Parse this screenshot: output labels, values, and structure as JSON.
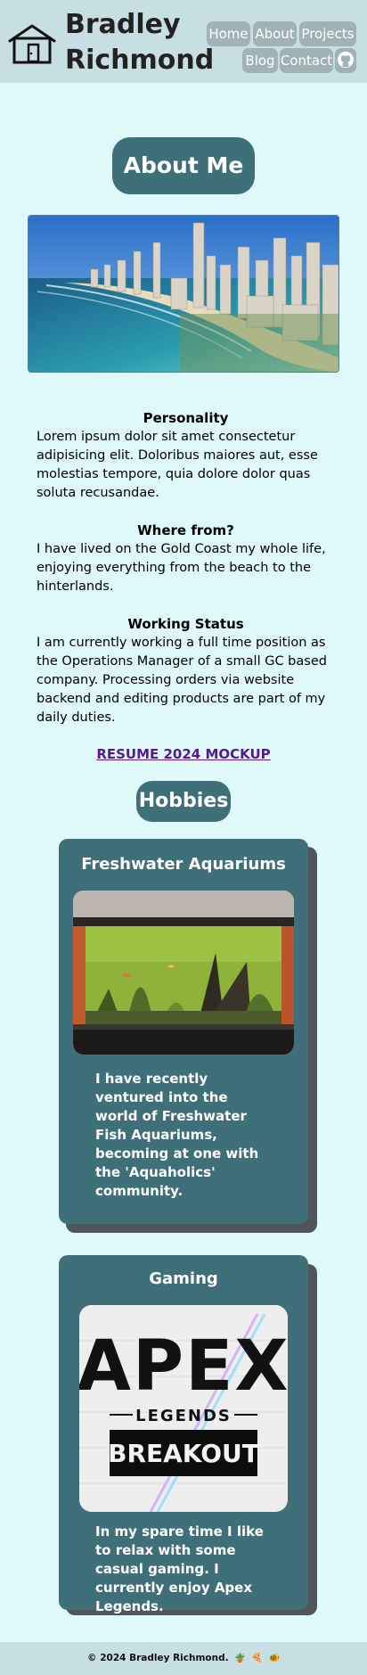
{
  "header": {
    "title_line1": "Bradley",
    "title_line2": "Richmond",
    "nav": {
      "home": "Home",
      "about": "About",
      "projects": "Projects",
      "blog": "Blog",
      "contact": "Contact"
    }
  },
  "about": {
    "heading": "About Me",
    "blocks": [
      {
        "title": "Personality",
        "text": "Lorem ipsum dolor sit amet consectetur adipisicing elit. Doloribus maiores aut, esse molestias tempore, quia dolore dolor quas soluta recusandae."
      },
      {
        "title": "Where from?",
        "text": "I have lived on the Gold Coast my whole life, enjoying everything from the beach to the hinterlands."
      },
      {
        "title": "Working Status",
        "text": "I am currently working a full time position as the Operations Manager of a small GC based company. Processing orders via website backend and editing products are part of my daily duties."
      }
    ],
    "resume_link": "RESUME 2024 MOCKUP"
  },
  "hobbies": {
    "heading": "Hobbies",
    "cards": [
      {
        "title": "Freshwater Aquariums",
        "text": "I have recently ventured into the world of Freshwater Fish Aquariums, becoming at one with the 'Aquaholics' community."
      },
      {
        "title": "Gaming",
        "text": "In my spare time I like to relax with some casual gaming. I currently enjoy Apex Legends.",
        "image_text": {
          "line1": "APEX",
          "line2": "LEGENDS",
          "line3": "BREAKOUT"
        }
      }
    ]
  },
  "footer": {
    "text": "© 2024 Bradley Richmond."
  },
  "colors": {
    "background": "#dff8f9",
    "header": "#c7dfe2",
    "accent": "#3f6f78",
    "nav": "#9fb3b6",
    "link": "#551a8b"
  }
}
